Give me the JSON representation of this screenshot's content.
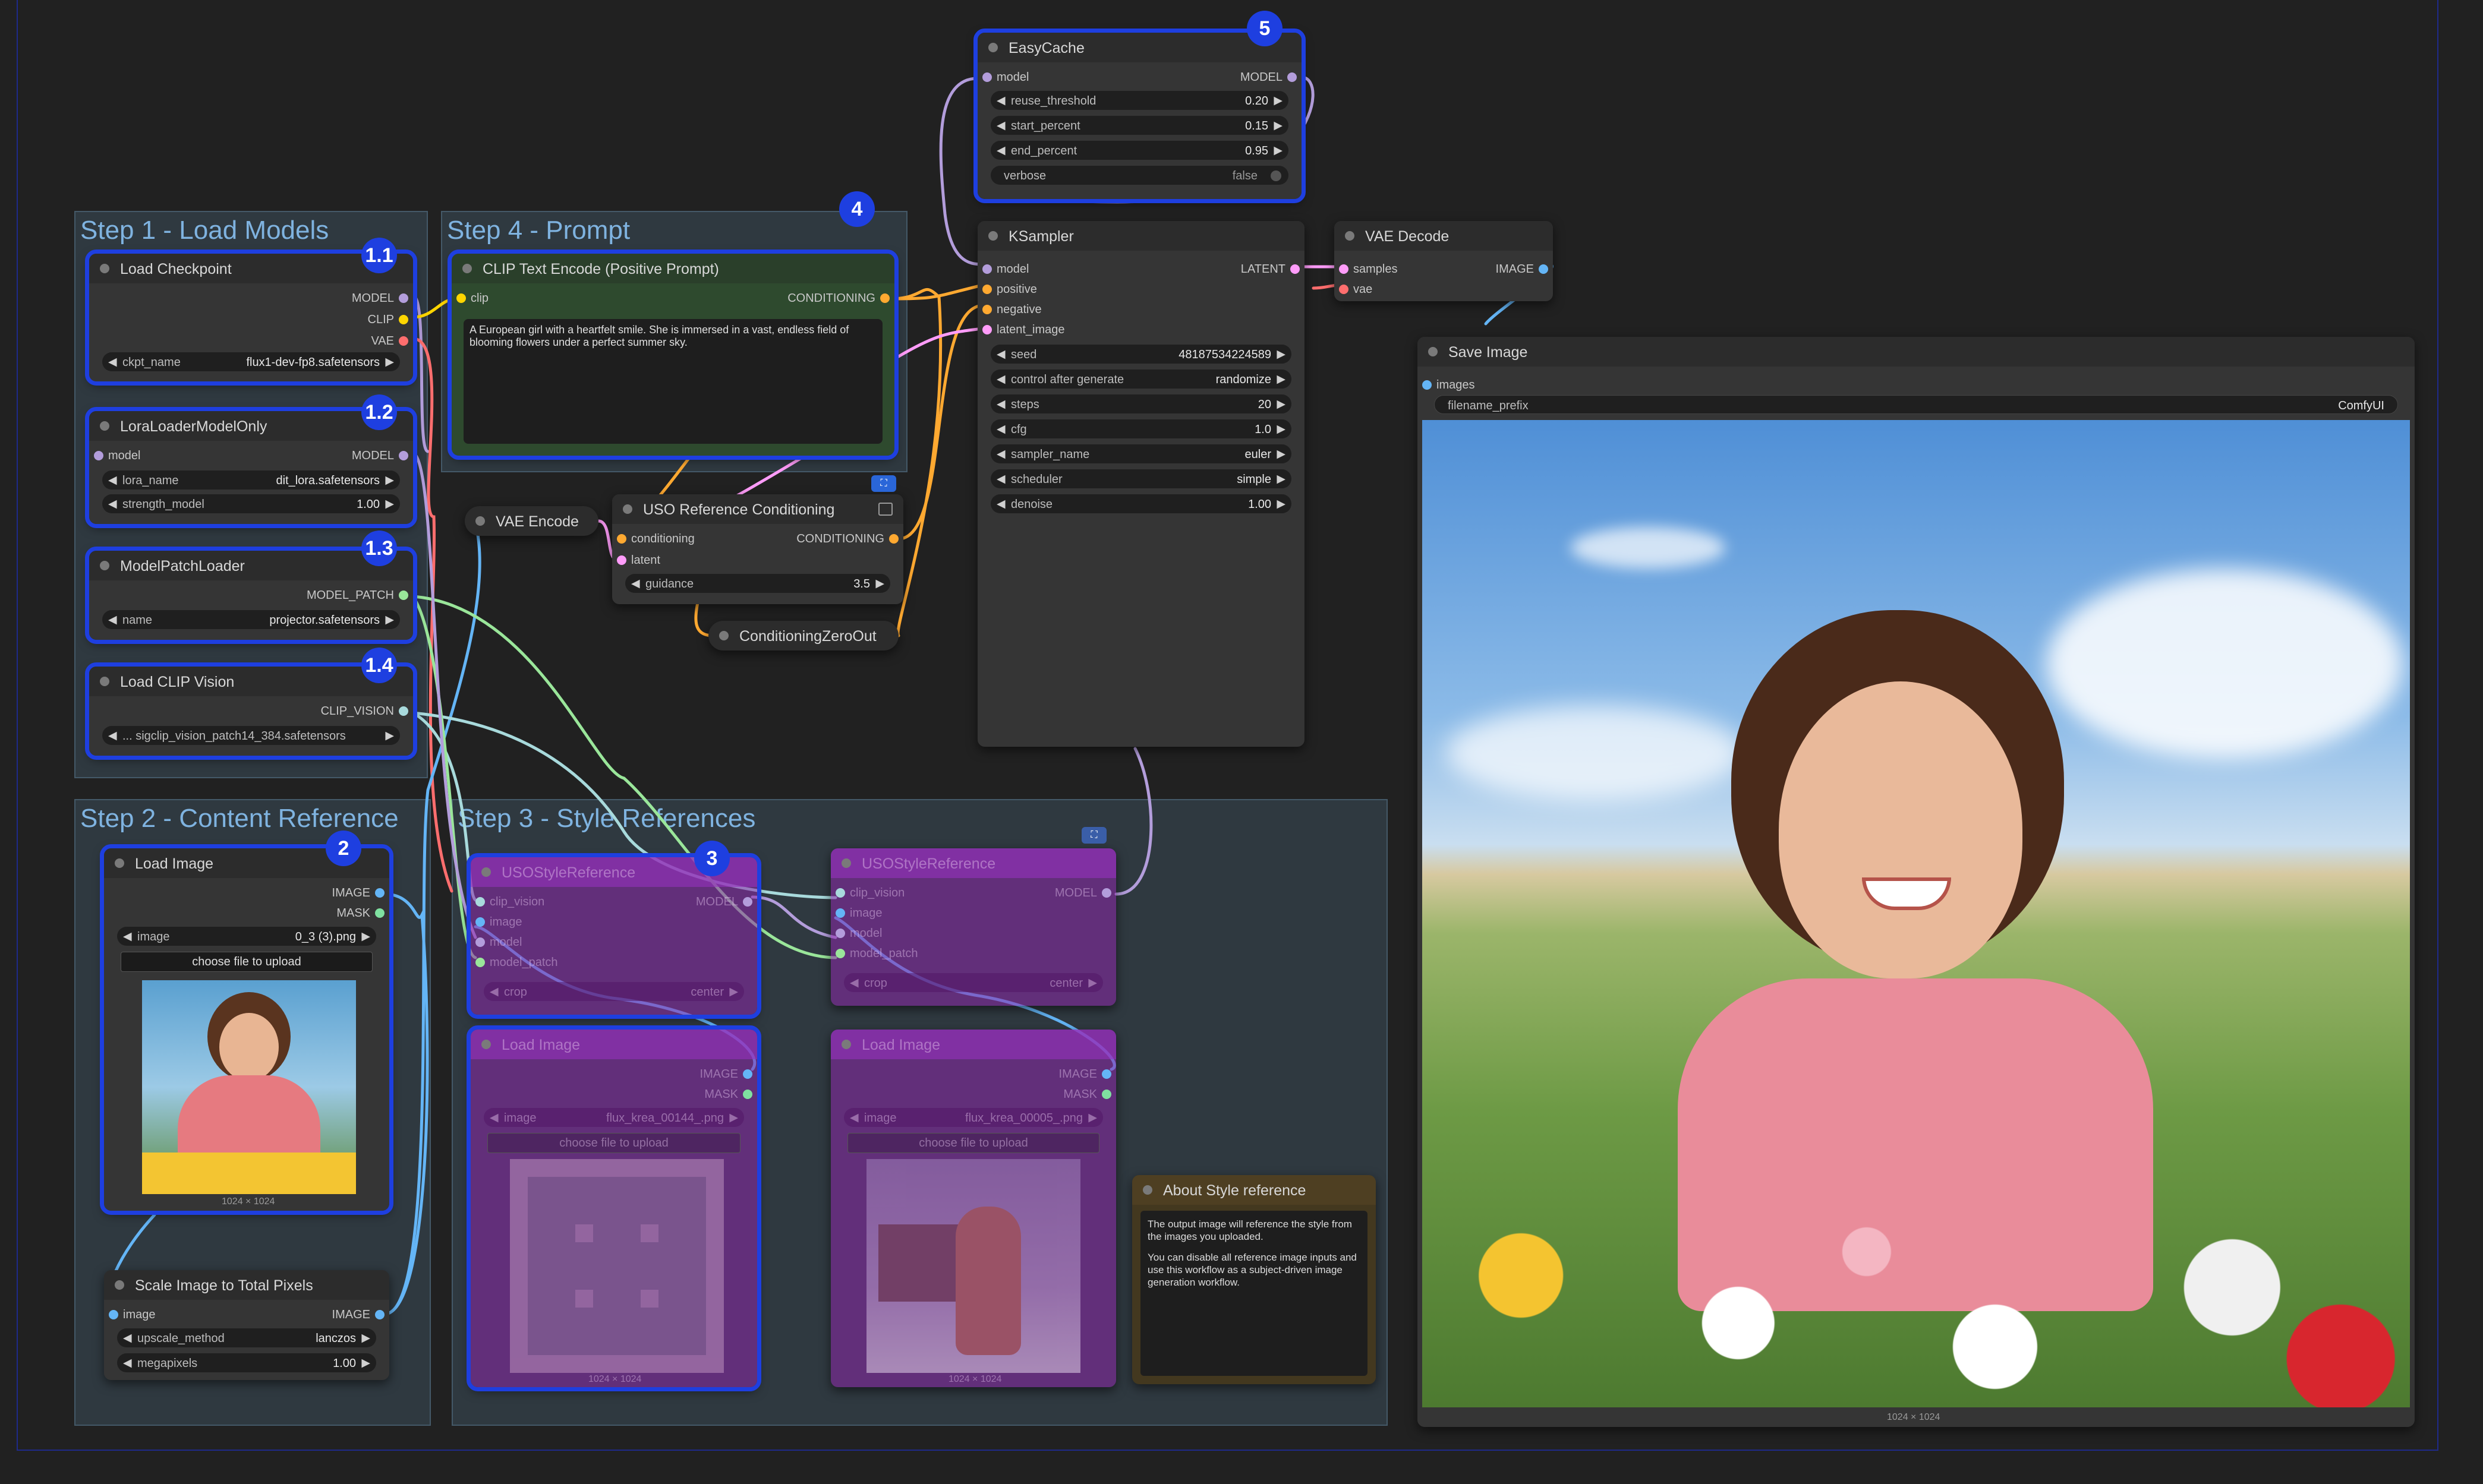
{
  "groups": [
    {
      "key": "g1",
      "title": "Step 1 - Load Models"
    },
    {
      "key": "g4",
      "title": "Step 4 - Prompt"
    },
    {
      "key": "g2",
      "title": "Step 2 - Content Reference"
    },
    {
      "key": "g3",
      "title": "Step 3 - Style References"
    }
  ],
  "badges": {
    "b11": "1.1",
    "b12": "1.2",
    "b13": "1.3",
    "b14": "1.4",
    "b2": "2",
    "b3": "3",
    "b4": "4",
    "b5": "5"
  },
  "load_checkpoint": {
    "title": "Load Checkpoint",
    "out_model": "MODEL",
    "out_clip": "CLIP",
    "out_vae": "VAE",
    "w_name": "ckpt_name",
    "w_value": "flux1-dev-fp8.safetensors"
  },
  "lora": {
    "title": "LoraLoaderModelOnly",
    "in_model": "model",
    "out_model": "MODEL",
    "w1_name": "lora_name",
    "w1_value": "dit_lora.safetensors",
    "w2_name": "strength_model",
    "w2_value": "1.00"
  },
  "patch": {
    "title": "ModelPatchLoader",
    "out": "MODEL_PATCH",
    "w_name": "name",
    "w_value": "projector.safetensors"
  },
  "clipvision": {
    "title": "Load CLIP Vision",
    "out": "CLIP_VISION",
    "w_value": "... sigclip_vision_patch14_384.safetensors"
  },
  "clip_text": {
    "title": "CLIP Text Encode (Positive Prompt)",
    "in_clip": "clip",
    "out": "CONDITIONING",
    "prompt": "A European girl with a heartfelt smile. She is immersed in a vast, endless field of blooming flowers under a perfect summer sky."
  },
  "vae_encode": {
    "title": "VAE Encode"
  },
  "uso_ref": {
    "title": "USO Reference Conditioning",
    "in_cond": "conditioning",
    "in_latent": "latent",
    "out": "CONDITIONING",
    "w_name": "guidance",
    "w_value": "3.5"
  },
  "zero_out": {
    "title": "ConditioningZeroOut"
  },
  "easycache": {
    "title": "EasyCache",
    "in_model": "model",
    "out_model": "MODEL",
    "w1_name": "reuse_threshold",
    "w1_value": "0.20",
    "w2_name": "start_percent",
    "w2_value": "0.15",
    "w3_name": "end_percent",
    "w3_value": "0.95",
    "w4_name": "verbose",
    "w4_value": "false"
  },
  "ksampler": {
    "title": "KSampler",
    "in_model": "model",
    "in_pos": "positive",
    "in_neg": "negative",
    "in_latent": "latent_image",
    "out": "LATENT",
    "widgets": [
      {
        "name": "seed",
        "value": "481875342245​89"
      },
      {
        "name": "control after generate",
        "value": "randomize"
      },
      {
        "name": "steps",
        "value": "20"
      },
      {
        "name": "cfg",
        "value": "1.0"
      },
      {
        "name": "sampler_name",
        "value": "euler"
      },
      {
        "name": "scheduler",
        "value": "simple"
      },
      {
        "name": "denoise",
        "value": "1.00"
      }
    ]
  },
  "vae_decode": {
    "title": "VAE Decode",
    "in_samples": "samples",
    "in_vae": "vae",
    "out": "IMAGE"
  },
  "save_image": {
    "title": "Save Image",
    "in_images": "images",
    "w_name": "filename_prefix",
    "w_value": "ComfyUI",
    "caption": "1024 × 1024"
  },
  "load_image": {
    "title": "Load Image",
    "out_image": "IMAGE",
    "out_mask": "MASK",
    "w_name": "image",
    "w_value": "0_3 (3).png",
    "upload": "choose file to upload",
    "caption": "1024 × 1024"
  },
  "scale_image": {
    "title": "Scale Image to Total Pixels",
    "in_image": "image",
    "out": "IMAGE",
    "w1_name": "upscale_method",
    "w1_value": "lanczos",
    "w2_name": "megapixels",
    "w2_value": "1.00"
  },
  "style_ref_1": {
    "title": "USOStyleReference",
    "in1": "clip_vision",
    "in2": "image",
    "in3": "model",
    "in4": "model_patch",
    "out": "MODEL",
    "w_name": "crop",
    "w_value": "center"
  },
  "style_ref_2": {
    "title": "USOStyleReference",
    "in1": "clip_vision",
    "in2": "image",
    "in3": "model",
    "in4": "model_patch",
    "out": "MODEL",
    "w_name": "crop",
    "w_value": "center"
  },
  "style_img_1": {
    "title": "Load Image",
    "out_image": "IMAGE",
    "out_mask": "MASK",
    "w_name": "image",
    "w_value": "flux_krea_00144_.png",
    "upload": "choose file to upload",
    "caption": "1024 × 1024"
  },
  "style_img_2": {
    "title": "Load Image",
    "out_image": "IMAGE",
    "out_mask": "MASK",
    "w_name": "image",
    "w_value": "flux_krea_00005_.png",
    "upload": "choose file to upload",
    "caption": "1024 × 1024"
  },
  "about": {
    "title": "About Style reference",
    "p1": "The output image will reference the style from the images you uploaded.",
    "p2": "You can disable all reference image inputs and use this workflow as a subject-driven image generation workflow."
  },
  "colors": {
    "model": "#b39ddb",
    "clip": "#ffd500",
    "vae": "#ff6e6e",
    "conditioning": "#ffa931",
    "latent": "#ff9cf9",
    "image": "#64b5f6",
    "clip_vision": "#a8dadc",
    "patch": "#9ae69a",
    "selection": "#1e3fe0"
  }
}
